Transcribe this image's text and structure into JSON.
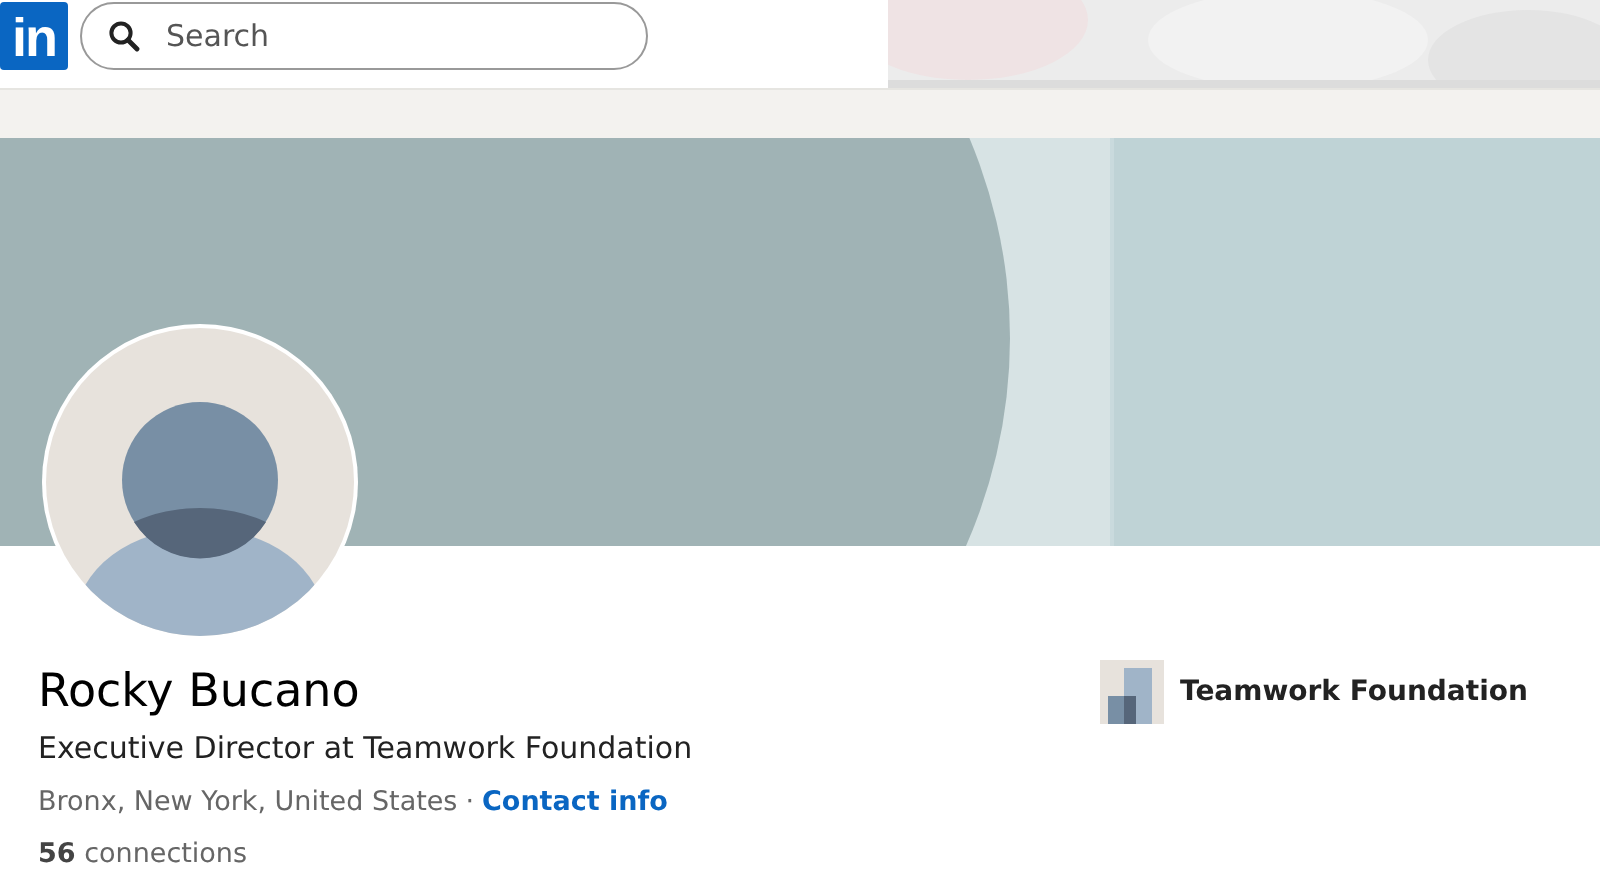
{
  "header": {
    "logo": "in",
    "search": {
      "placeholder": "Search"
    }
  },
  "profile": {
    "name": "Rocky Bucano",
    "headline": "Executive Director at Teamwork Foundation",
    "location": "Bronx, New York, United States",
    "separator": "·",
    "contact_link": "Contact info",
    "connections": "**56** connections"
  },
  "company": {
    "name": "Teamwork Foundation"
  }
}
